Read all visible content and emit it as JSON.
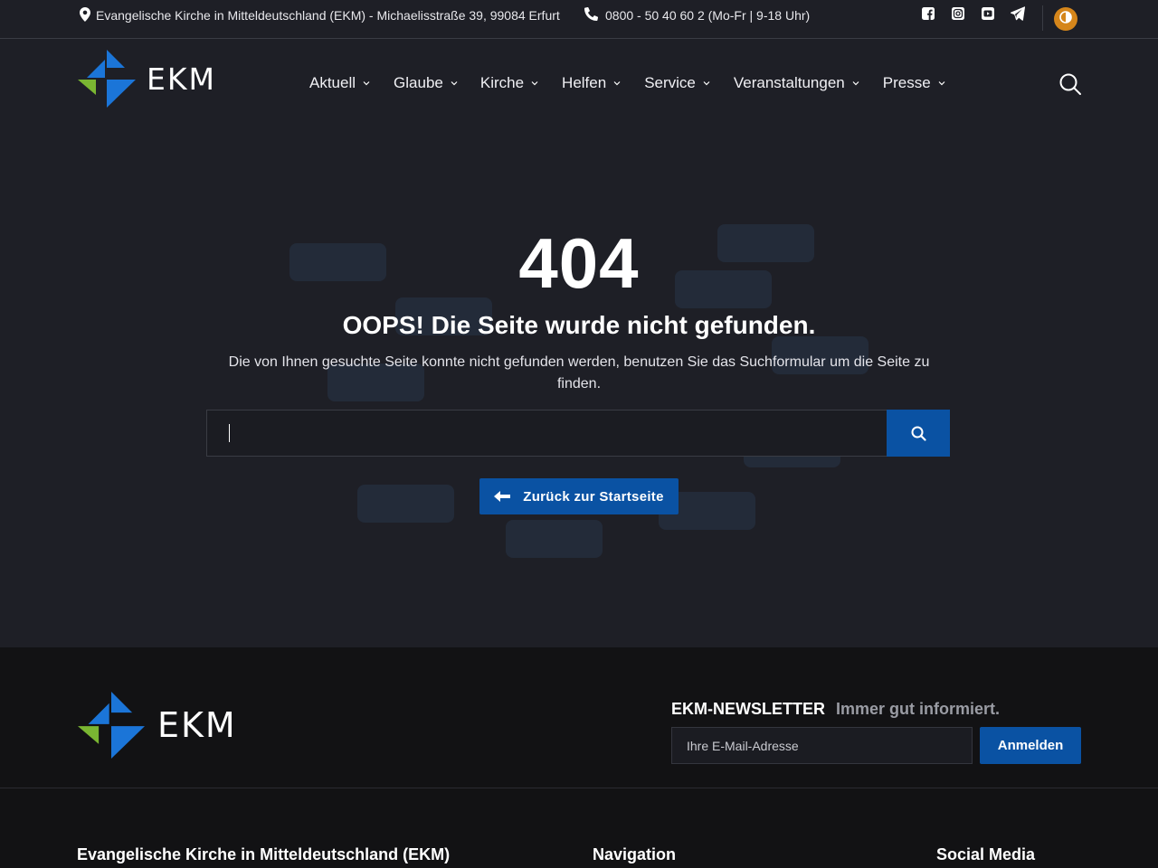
{
  "topbar": {
    "address": "Evangelische Kirche in Mitteldeutschland (EKM) - Michaelisstraße 39, 99084 Erfurt",
    "phone": "0800 - 50 40 60 2 (Mo-Fr | 9-18 Uhr)",
    "socials": [
      "facebook-icon",
      "instagram-icon",
      "youtube-icon",
      "telegram-icon"
    ],
    "contrast_toggle": "contrast-icon"
  },
  "header": {
    "logo_text": "EKM",
    "nav": [
      {
        "label": "Aktuell"
      },
      {
        "label": "Glaube"
      },
      {
        "label": "Kirche"
      },
      {
        "label": "Helfen"
      },
      {
        "label": "Service"
      },
      {
        "label": "Veranstaltungen"
      },
      {
        "label": "Presse"
      }
    ]
  },
  "error": {
    "code": "404",
    "title": "OOPS! Die Seite wurde nicht gefunden.",
    "text": "Die von Ihnen gesuchte Seite konnte nicht gefunden werden, benutzen Sie das Suchformular um die Seite zu finden.",
    "search_value": "",
    "back_label": "Zurück zur Startseite"
  },
  "footer": {
    "logo_text": "EKM",
    "newsletter_title": "EKM-NEWSLETTER",
    "newsletter_subtitle": "Immer gut informiert.",
    "email_placeholder": "Ihre E-Mail-Adresse",
    "subscribe_label": "Anmelden",
    "columns": [
      {
        "title": "Evangelische Kirche in Mitteldeutschland (EKM)"
      },
      {
        "title": "Navigation"
      },
      {
        "title": "Social Media"
      }
    ]
  },
  "colors": {
    "background": "#1e1f26",
    "footer_background": "#121214",
    "accent_blue": "#0a52a3",
    "logo_blue": "#1b75d8",
    "logo_green": "#7ab632",
    "contrast_orange": "#d5861b"
  }
}
